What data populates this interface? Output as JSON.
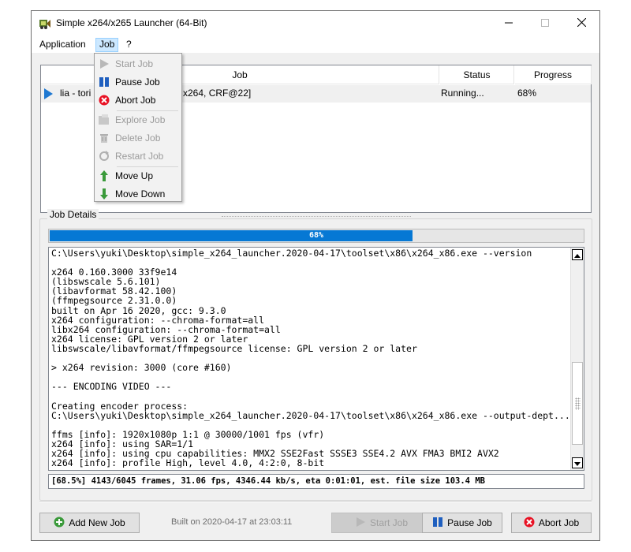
{
  "window": {
    "title": "Simple x264/x265 Launcher (64-Bit)"
  },
  "menubar": {
    "items": [
      "Application",
      "Job",
      "?"
    ]
  },
  "job_menu": {
    "items": [
      {
        "label": "Start Job",
        "icon": "play-icon",
        "enabled": false
      },
      {
        "label": "Pause Job",
        "icon": "pause-icon",
        "enabled": true
      },
      {
        "label": "Abort Job",
        "icon": "abort-icon",
        "enabled": true
      },
      {
        "label": "Explore Job",
        "icon": "explore-icon",
        "enabled": false
      },
      {
        "label": "Delete Job",
        "icon": "trash-icon",
        "enabled": false
      },
      {
        "label": "Restart Job",
        "icon": "restart-icon",
        "enabled": false
      },
      {
        "label": "Move Up",
        "icon": "arrow-up-icon",
        "enabled": true
      },
      {
        "label": "Move Down",
        "icon": "arrow-down-icon",
        "enabled": true
      }
    ]
  },
  "job_table": {
    "columns": [
      "Job",
      "Status",
      "Progress"
    ],
    "rows": [
      {
        "name": "lia - tori",
        "name_tail": "x264, CRF@22]",
        "status": "Running...",
        "progress": "68%"
      }
    ]
  },
  "job_details": {
    "label": "Job Details",
    "progress_text": "68%",
    "progress_fraction": 0.68,
    "log_lines": [
      "C:\\Users\\yuki\\Desktop\\simple_x264_launcher.2020-04-17\\toolset\\x86\\x264_x86.exe --version",
      "",
      "x264 0.160.3000 33f9e14",
      "(libswscale 5.6.101)",
      "(libavformat 58.42.100)",
      "(ffmpegsource 2.31.0.0)",
      "built on Apr 16 2020, gcc: 9.3.0",
      "x264 configuration: --chroma-format=all",
      "libx264 configuration: --chroma-format=all",
      "x264 license: GPL version 2 or later",
      "libswscale/libavformat/ffmpegsource license: GPL version 2 or later",
      "",
      "> x264 revision: 3000 (core #160)",
      "",
      "--- ENCODING VIDEO ---",
      "",
      "Creating encoder process:",
      "C:\\Users\\yuki\\Desktop\\simple_x264_launcher.2020-04-17\\toolset\\x86\\x264_x86.exe --output-dept...",
      "",
      "ffms [info]: 1920x1080p 1:1 @ 30000/1001 fps (vfr)",
      "x264 [info]: using SAR=1/1",
      "x264 [info]: using cpu capabilities: MMX2 SSE2Fast SSSE3 SSE4.2 AVX FMA3 BMI2 AVX2",
      "x264 [info]: profile High, level 4.0, 4:2:0, 8-bit"
    ],
    "status_line": "[68.5%] 4143/6045 frames, 31.06 fps, 4346.44 kb/s, eta 0:01:01, est. file size 103.4 MB"
  },
  "bottom_bar": {
    "add_new_job": "Add New Job",
    "built_on": "Built on 2020-04-17 at 23:03:11",
    "start_job": "Start Job",
    "pause_job": "Pause Job",
    "abort_job": "Abort Job"
  },
  "colors": {
    "accent": "#0678d4",
    "menu_highlight": "#cce8ff",
    "abort_red": "#e81123",
    "pause_blue": "#1f5fbf",
    "move_green": "#3a9a3a"
  }
}
